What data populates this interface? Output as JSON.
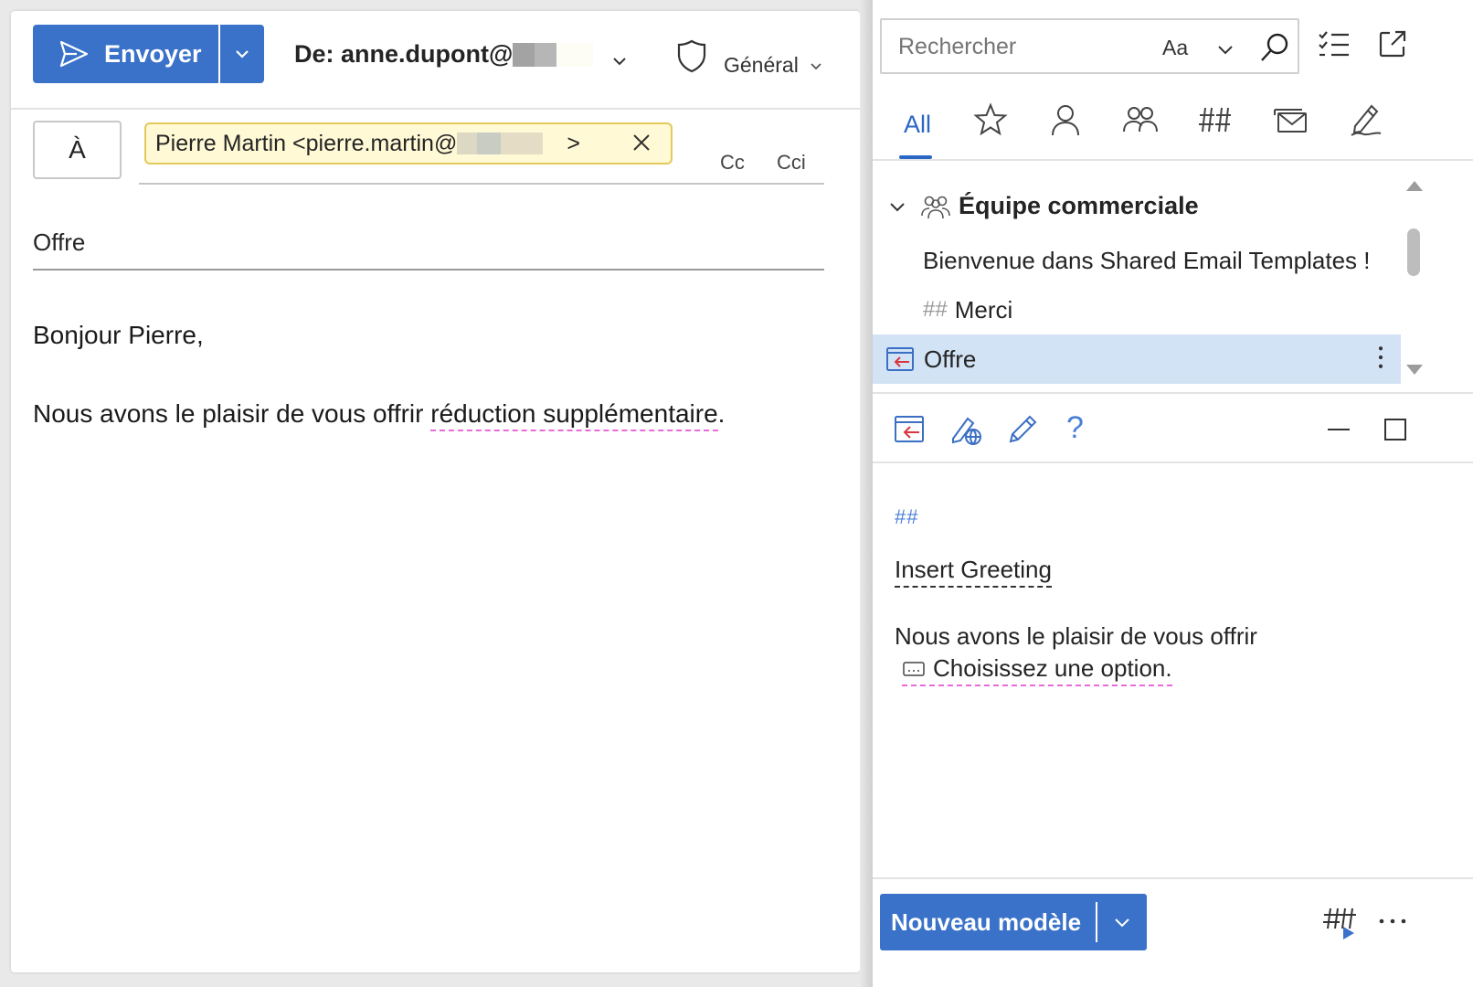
{
  "compose": {
    "send_label": "Envoyer",
    "from_prefix": "De: anne.dupont@",
    "sensitivity_label": "Général",
    "to_label": "À",
    "recipient_text": "Pierre Martin <pierre.martin@",
    "recipient_suffix": ">",
    "cc_label": "Cc",
    "bcc_label": "Cci",
    "subject": "Offre",
    "greeting": "Bonjour Pierre,",
    "body_start": "Nous avons le plaisir de vous offrir ",
    "body_flagged": "réduction supplémentaire",
    "body_end": "."
  },
  "pane": {
    "search_placeholder": "Rechercher",
    "search_case_label": "Aa",
    "tab_all_label": "All",
    "group_name": "Équipe commerciale",
    "items": [
      {
        "label": "Bienvenue dans Shared Email Templates !"
      },
      {
        "prefix": "##",
        "label": "Merci"
      },
      {
        "label": "Offre"
      }
    ],
    "preview": {
      "macro": "##",
      "greeting_macro": "Insert Greeting",
      "line1": "Nous avons le plaisir de vous offrir",
      "line2": "Choisissez une option."
    },
    "help_glyph": "?",
    "new_template_label": "Nouveau modèle"
  },
  "colors": {
    "accent": "#3a72c9",
    "tab_active": "#2a66c6",
    "selected_row": "#d3e3f6",
    "recipient_bg": "#fff9d6",
    "spell_underline": "#e96ad9"
  },
  "icons": [
    "send-icon",
    "chevron-down-icon",
    "shield-icon",
    "close-icon",
    "search-icon",
    "checklist-icon",
    "popout-icon",
    "star-icon",
    "person-icon",
    "people-icon",
    "hash-icon",
    "mail-stack-icon",
    "signature-icon",
    "insert-template-icon",
    "web-edit-icon",
    "pencil-icon",
    "minimize-icon",
    "maximize-icon",
    "more-vertical-icon",
    "more-horizontal-icon",
    "dropdown-field-icon",
    "macro-run-icon"
  ]
}
